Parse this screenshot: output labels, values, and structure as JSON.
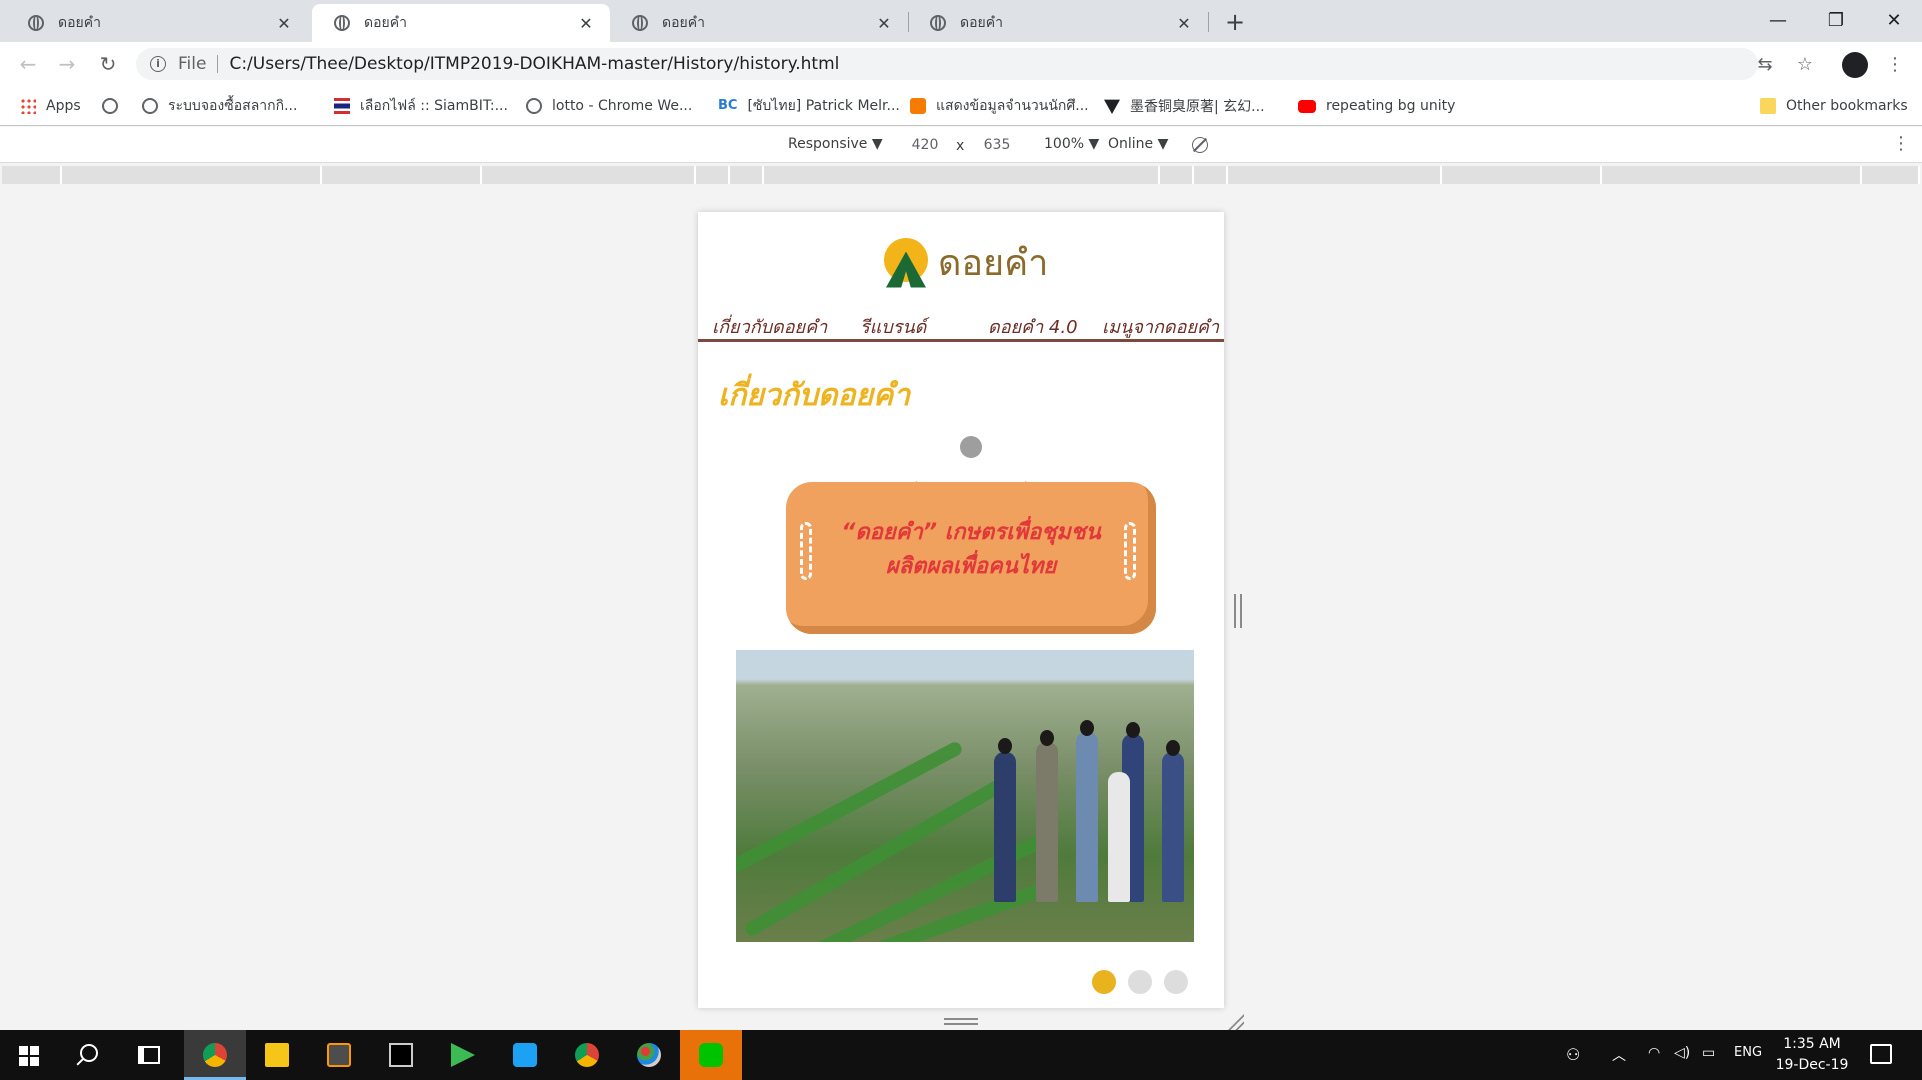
{
  "browser": {
    "tabs": [
      {
        "title": "ดอยคำ",
        "active": false
      },
      {
        "title": "ดอยคำ",
        "active": true
      },
      {
        "title": "ดอยคำ",
        "active": false
      },
      {
        "title": "ดอยคำ",
        "active": false
      }
    ],
    "tab_close_glyph": "✕",
    "new_tab_glyph": "+",
    "window_controls": {
      "minimize": "—",
      "restore": "❐",
      "close": "✕"
    },
    "toolbar": {
      "back": "←",
      "forward": "→",
      "reload": "↻",
      "translate": "⇆",
      "bookmark_star": "☆",
      "menu": "⋮"
    },
    "address": {
      "scheme": "File",
      "url": "C:/Users/Thee/Desktop/ITMP2019-DOIKHAM-master/History/history.html"
    },
    "bookmarks": [
      {
        "label": "Apps",
        "icon": "apps-grid-icon"
      },
      {
        "label": "",
        "icon": "globe-icon"
      },
      {
        "label": "ระบบจองซื้อสลากกิ...",
        "icon": "globe-icon"
      },
      {
        "label": "เลือกไฟล์ :: SiamBIT:...",
        "icon": "thai-flag-icon"
      },
      {
        "label": "lotto - Chrome We...",
        "icon": "globe-icon"
      },
      {
        "label": "[ซับไทย] Patrick Melr...",
        "icon": "bc-icon",
        "icon_text": "BC"
      },
      {
        "label": "แสดงข้อมูลจำนวนนักศึ...",
        "icon": "orange-site-icon"
      },
      {
        "label": "墨香铜臭原著| 玄幻...",
        "icon": "dark-shield-icon"
      },
      {
        "label": "repeating bg unity",
        "icon": "youtube-icon"
      }
    ],
    "other_bookmarks": "Other bookmarks"
  },
  "devtools": {
    "device": "Responsive ▼",
    "width": "420",
    "times": "x",
    "height": "635",
    "zoom": "100% ▼",
    "network": "Online ▼",
    "more": "⋮"
  },
  "page": {
    "logo_text": "ดอยคำ",
    "nav": [
      "เกี่ยวกับดอยคำ",
      "รีแบรนด์",
      "ดอยคำ 4.0",
      "เมนูจากดอยคำ"
    ],
    "heading": "เกี่ยวกับดอยคำ",
    "sign_line1": "“ดอยคำ” เกษตรเพื่อชุมชน",
    "sign_line2": "ผลิตผลเพื่อคนไทย",
    "carousel_active_index": 0,
    "carousel_count": 3,
    "colors": {
      "accent": "#e8b31f",
      "nav": "#6b2e27",
      "sign": "#f0a15e"
    }
  },
  "taskbar": {
    "apps": [
      "chrome-icon",
      "file-explorer-icon",
      "sublime-icon",
      "terminal-icon",
      "media-player-icon",
      "twitter-icon",
      "chrome-icon",
      "paint-icon",
      "line-icon"
    ],
    "language": "ENG",
    "time": "1:35 AM",
    "date": "19-Dec-19"
  }
}
